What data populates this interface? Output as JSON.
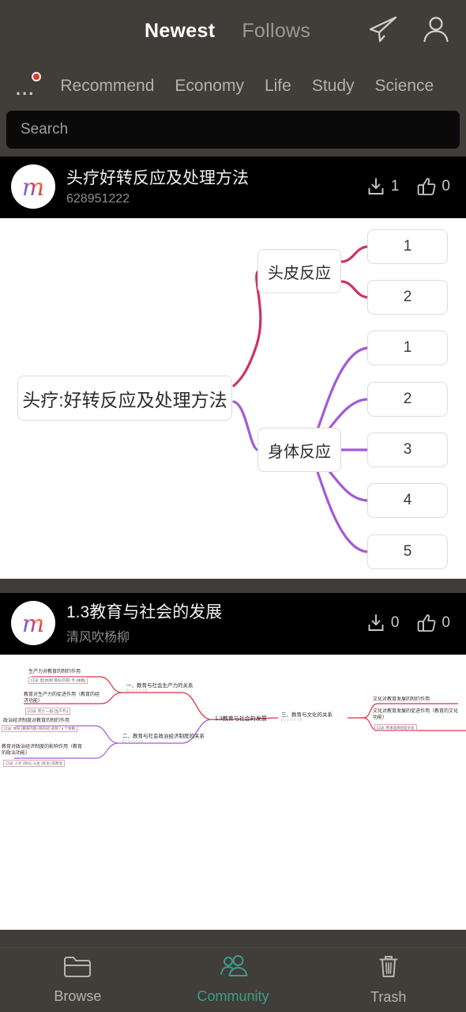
{
  "header": {
    "tabs": [
      {
        "label": "Newest",
        "active": true
      },
      {
        "label": "Follows",
        "active": false
      }
    ],
    "icons": {
      "send": "send-icon",
      "profile": "profile-icon"
    }
  },
  "categories": {
    "more_label": "...",
    "has_badge": true,
    "items": [
      "Recommend",
      "Economy",
      "Life",
      "Study",
      "Science"
    ]
  },
  "search": {
    "placeholder": "Search",
    "value": ""
  },
  "cards": [
    {
      "title": "头疗好转反应及处理方法",
      "author": "628951222",
      "downloads": "1",
      "likes": "0",
      "avatar_glyph": "m",
      "mindmap": {
        "root": "头疗:好转反应及处理方法",
        "branches": [
          {
            "label": "头皮反应",
            "color": "#cc3366",
            "children": [
              "1",
              "2"
            ]
          },
          {
            "label": "身体反应",
            "color": "#a45ad6",
            "children": [
              "1",
              "2",
              "3",
              "4",
              "5"
            ]
          }
        ]
      }
    },
    {
      "title": "1.3教育与社会的发展",
      "author": "清风吹杨柳",
      "downloads": "0",
      "likes": "0",
      "avatar_glyph": "m",
      "mindmap": {
        "root": "1.3教育与社会的发展",
        "branches": [
          {
            "label": "一、教育与社会生产力的关系",
            "stars": "(☆☆☆☆☆)",
            "color": "#d9333f",
            "children": [
              {
                "text": "生产力对教育的制约作用",
                "sub": "口诀: 型(体)制 目标(内容) 专 (规模)"
              },
              {
                "text": "教育对生产力的促进作用（教育的经济功能）",
                "sub": "[口诀: 劳力 一般 (生产不)]"
              }
            ]
          },
          {
            "label": "二、教育与社会政治经济制度的关系",
            "stars": "(☆☆☆☆☆)",
            "color": "#a45ad6",
            "children": [
              {
                "text": "政治经济制度对教育的制约作用",
                "sub": "口诀: 领导 (教育内容+目的对) 权利 / 5 个体制"
              },
              {
                "text": "教育对政治经济制度的影响作用（教育的政治功能）",
                "sub": "口诀: 人才 (舆论) 公主 (民主) 促政治"
              }
            ]
          },
          {
            "label": "三、教育与文化的关系",
            "stars": "(☆☆☆☆☆)",
            "color": "#d9333f",
            "children": [
              {
                "text": "文化对教育发展的制约作用",
                "sub": ""
              },
              {
                "text": "文化对教育发展的促进作用（教育的文化功能）",
                "sub": "口诀: 传承选择创造文化"
              }
            ]
          }
        ]
      }
    }
  ],
  "bottom_nav": [
    {
      "label": "Browse",
      "icon": "folder-icon",
      "active": false
    },
    {
      "label": "Community",
      "icon": "people-icon",
      "active": true
    },
    {
      "label": "Trash",
      "icon": "trash-icon",
      "active": false
    }
  ],
  "colors": {
    "chrome": "#413d39",
    "card_bg": "#000000",
    "accent_teal": "#3a9e8c",
    "badge_red": "#e8352b",
    "branch_pink": "#cc3366",
    "branch_purple": "#a45ad6"
  }
}
